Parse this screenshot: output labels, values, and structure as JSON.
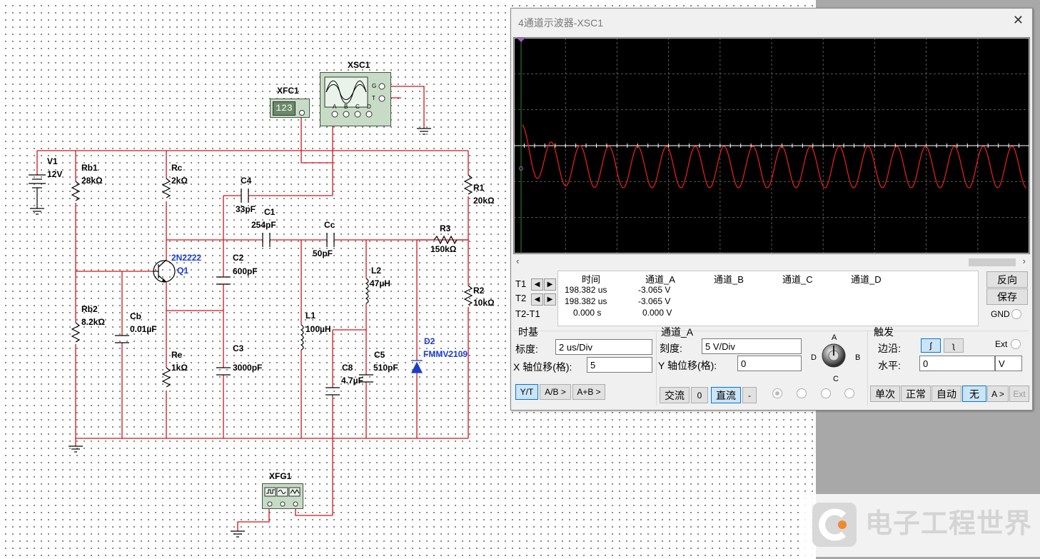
{
  "schematic": {
    "labels": {
      "xsc1": "XSC1",
      "xfc1": "XFC1",
      "xfc1_display": "123",
      "xfg1": "XFG1",
      "v1_name": "V1",
      "v1_value": "12V",
      "rb1_name": "Rb1",
      "rb1_value": "28kΩ",
      "rc_name": "Rc",
      "rc_value": "2kΩ",
      "c4_name": "C4",
      "c4_value": "33pF",
      "c1_name": "C1",
      "c1_value": "254pF",
      "cc_name": "Cc",
      "cc_value": "50pF",
      "r3_name": "R3",
      "r3_value": "150kΩ",
      "r1_name": "R1",
      "r1_value": "20kΩ",
      "r2_name": "R2",
      "r2_value": "10kΩ",
      "q1_model": "2N2222",
      "q1_name": "Q1",
      "c2_name": "C2",
      "c2_value": "600pF",
      "rb2_name": "Rb2",
      "rb2_value": "8.2kΩ",
      "cb_name": "Cb",
      "cb_value": "0.01µF",
      "re_name": "Re",
      "re_value": "1kΩ",
      "c3_name": "C3",
      "c3_value": "3000pF",
      "l1_name": "L1",
      "l1_value": "100µH",
      "l2_name": "L2",
      "l2_value": "47µH",
      "c8_name": "C8",
      "c8_value": "4.7µF",
      "c5_name": "C5",
      "c5_value": "510pF",
      "d2_name": "D2",
      "d2_model": "FMMV2109",
      "scope_term_a": "A",
      "scope_term_b": "B",
      "scope_term_c": "C",
      "scope_term_d": "D",
      "scope_term_g": "G",
      "scope_term_t": "T"
    },
    "colors": {
      "wire": "#d0141c",
      "component": "#000000",
      "blue_part": "#1a3ccf"
    }
  },
  "oscilloscope": {
    "title": "4通道示波器-XSC1",
    "close_icon": "close-icon",
    "trace": {
      "color": "#e0201c",
      "cycles": 17.5,
      "amplitude_div": 1.05
    },
    "readout": {
      "headers": [
        "时间",
        "通道_A",
        "通道_B",
        "通道_C",
        "通道_D"
      ],
      "t1_label": "T1",
      "t2_label": "T2",
      "t2t1_label": "T2-T1",
      "t1": {
        "time": "198.382 us",
        "a": "-3.065 V"
      },
      "t2": {
        "time": "198.382 us",
        "a": "-3.065 V"
      },
      "diff": {
        "time": "0.000 s",
        "a": "0.000 V"
      }
    },
    "buttons": {
      "reverse": "反向",
      "save": "保存",
      "gnd": "GND"
    },
    "timebase": {
      "title": "时基",
      "scale_label": "标度:",
      "scale_value": "2 us/Div",
      "xpos_label": "X 轴位移(格):",
      "xpos_value": "5",
      "modes": [
        "Y/T",
        "A/B >",
        "A+B >"
      ]
    },
    "channel": {
      "title": "通道_A",
      "scale_label": "刻度:",
      "scale_value": "5  V/Div",
      "ypos_label": "Y 轴位移(格):",
      "ypos_value": "0",
      "coupling": [
        "交流",
        "0",
        "直流",
        "-"
      ],
      "knob_a": "A",
      "knob_b": "B",
      "knob_c": "C",
      "knob_d": "D"
    },
    "trigger": {
      "title": "触发",
      "edge_label": "边沿:",
      "ext_label": "Ext",
      "level_label": "水平:",
      "level_value": "0",
      "level_unit": "V",
      "modes": [
        "单次",
        "正常",
        "自动",
        "无",
        "A >",
        "Ext"
      ]
    }
  },
  "watermark": {
    "text": "电子工程世界"
  }
}
